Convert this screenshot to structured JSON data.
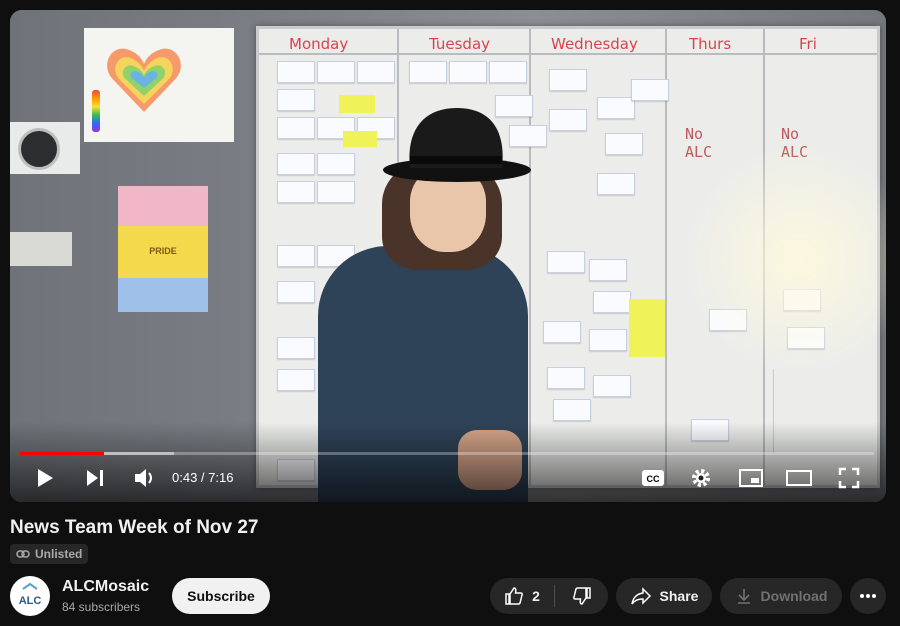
{
  "video": {
    "board_days": [
      "Monday",
      "Tuesday",
      "Wednesday",
      "Thurs",
      "Fri"
    ],
    "board_notes": [
      "No ALC",
      "No ALC"
    ],
    "poster_text": "PRIDE",
    "progress_fraction": 0.098,
    "buffered_fraction": 0.18,
    "time": "0:43 / 7:16",
    "accent_color": "#ff0000"
  },
  "meta": {
    "title": "News Team Week of Nov 27",
    "visibility": "Unlisted"
  },
  "channel": {
    "name": "ALCMosaic",
    "subscribers": "84 subscribers",
    "avatar_text": "ALC"
  },
  "actions": {
    "subscribe": "Subscribe",
    "likes": "2",
    "share": "Share",
    "download": "Download"
  },
  "icons": [
    "play-icon",
    "next-icon",
    "volume-icon",
    "captions-icon",
    "settings-icon",
    "miniplayer-icon",
    "theater-icon",
    "fullscreen-icon",
    "link-icon",
    "like-icon",
    "dislike-icon",
    "share-icon",
    "download-icon",
    "more-icon"
  ]
}
